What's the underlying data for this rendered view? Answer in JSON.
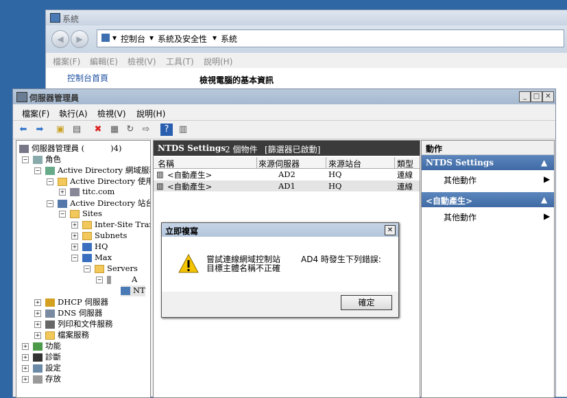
{
  "system_window": {
    "title": "系統",
    "breadcrumb": [
      "控制台",
      "系統及安全性",
      "系統"
    ],
    "menu": [
      "檔案(F)",
      "編輯(E)",
      "檢視(V)",
      "工具(T)",
      "說明(H)"
    ],
    "left_link": "控制台首頁",
    "heading": "檢視電腦的基本資訊"
  },
  "server_manager": {
    "title": "伺服器管理員",
    "menu": [
      "檔案(F)",
      "執行(A)",
      "檢視(V)",
      "說明(H)"
    ],
    "tree": {
      "root": "伺服器管理員 (",
      "root_suffix": ")4)",
      "roles": "角色",
      "ad_ds": "Active Directory 網域服務",
      "ad_users": "Active Directory 使用者",
      "domain": "titc.com",
      "ad_sites": "Active Directory 站台及",
      "sites": "Sites",
      "inter_site": "Inter-Site Trans",
      "subnets": "Subnets",
      "hq": "HQ",
      "site2": "Max",
      "servers": "Servers",
      "server_ad": "A",
      "ntds_node": "NT",
      "dhcp": "DHCP 伺服器",
      "dns": "DNS 伺服器",
      "print": "列印和文件服務",
      "file": "檔案服務",
      "features": "功能",
      "diagnostics": "診斷",
      "config": "設定",
      "storage": "存放"
    },
    "center": {
      "header_title": "NTDS Settings",
      "header_count": "2 個物件",
      "header_filter": "[篩選器已啟動]",
      "columns": [
        "名稱",
        "來源伺服器",
        "來源站台",
        "類型"
      ],
      "rows": [
        {
          "name": "<自動產生>",
          "server": "AD2",
          "site": "HQ",
          "type": "連線"
        },
        {
          "name": "<自動產生>",
          "server": "AD1",
          "site": "HQ",
          "type": "連線"
        }
      ]
    },
    "actions": {
      "title": "動作",
      "section1": "NTDS Settings",
      "section1_item": "其他動作",
      "section2": "<自動產生>",
      "section2_item": "其他動作"
    }
  },
  "dialog": {
    "title": "立即複寫",
    "line1": "嘗試連線網域控制站",
    "line1_cont": "AD4 時發生下列錯誤:",
    "line2": "目標主體名稱不正確",
    "ok": "確定"
  }
}
